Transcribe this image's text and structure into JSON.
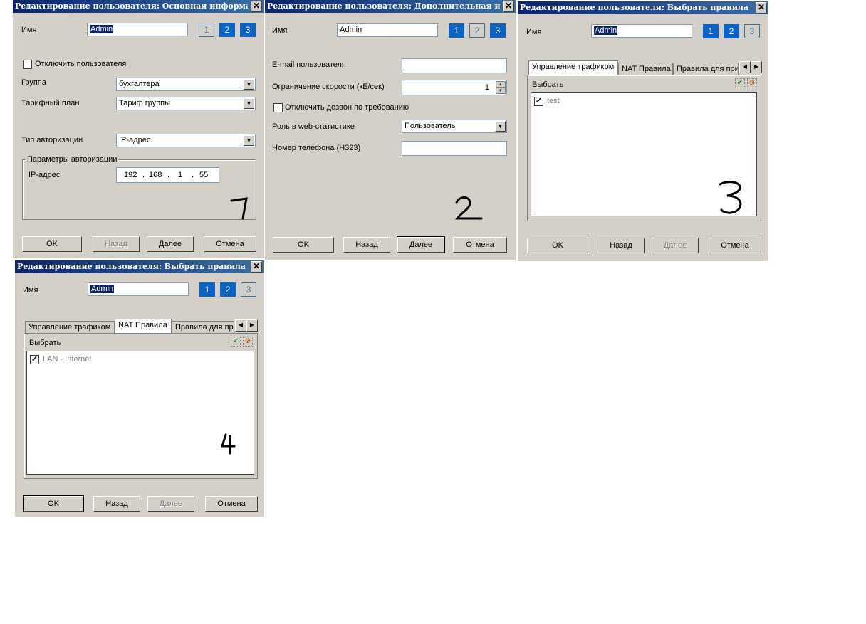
{
  "common": {
    "name_label": "Имя",
    "name_value": "Admin",
    "steps": [
      "1",
      "2",
      "3"
    ],
    "ok": "OK",
    "back": "Назад",
    "next": "Далее",
    "cancel": "Отмена",
    "close": "✕"
  },
  "dialog1": {
    "title": "Редактирование пользователя: Основная информация",
    "disable_user": "Отключить пользователя",
    "group_label": "Группа",
    "group_value": "бухгалтера",
    "tariff_label": "Тарифный план",
    "tariff_value": "Тариф группы",
    "auth_type_label": "Тип авторизации",
    "auth_type_value": "IP-адрес",
    "auth_params_title": "Параметры авторизации",
    "ip_label": "IP-адрес",
    "ip": [
      "192",
      "168",
      "1",
      "55"
    ],
    "annotation": "1"
  },
  "dialog2": {
    "title": "Редактирование пользователя: Дополнительная инф...",
    "email_label": "E-mail пользователя",
    "email_value": "",
    "speed_label": "Ограничение скорости (кБ/сек)",
    "speed_value": "1",
    "dialup_label": "Отключить дозвон по требованию",
    "role_label": "Роль в web-статистике",
    "role_value": "Пользователь",
    "phone_label": "Номер телефона (H323)",
    "phone_value": "",
    "annotation": "2"
  },
  "dialog3": {
    "title": "Редактирование пользователя: Выбрать правила",
    "tabs": [
      "Управление трафиком",
      "NAT Правила",
      "Правила для при"
    ],
    "select_label": "Выбрать",
    "items": [
      "test"
    ],
    "annotation": "3"
  },
  "dialog4": {
    "title": "Редактирование пользователя: Выбрать правила",
    "tabs": [
      "Управление трафиком",
      "NAT Правила",
      "Правила для при"
    ],
    "select_label": "Выбрать",
    "items": [
      "LAN - Internet"
    ],
    "annotation": "4"
  },
  "colors": {
    "title_gradient_start": "#0a246a",
    "title_gradient_end": "#3a6ea5",
    "dialog_bg": "#d4d0c8",
    "step_active": "#0a64c8"
  },
  "icons": [
    "close-icon",
    "dropdown-arrow-icon",
    "checkmark-icon",
    "check-all-icon",
    "uncheck-all-icon",
    "spin-up-icon",
    "spin-down-icon",
    "tab-scroll-left-icon",
    "tab-scroll-right-icon"
  ]
}
